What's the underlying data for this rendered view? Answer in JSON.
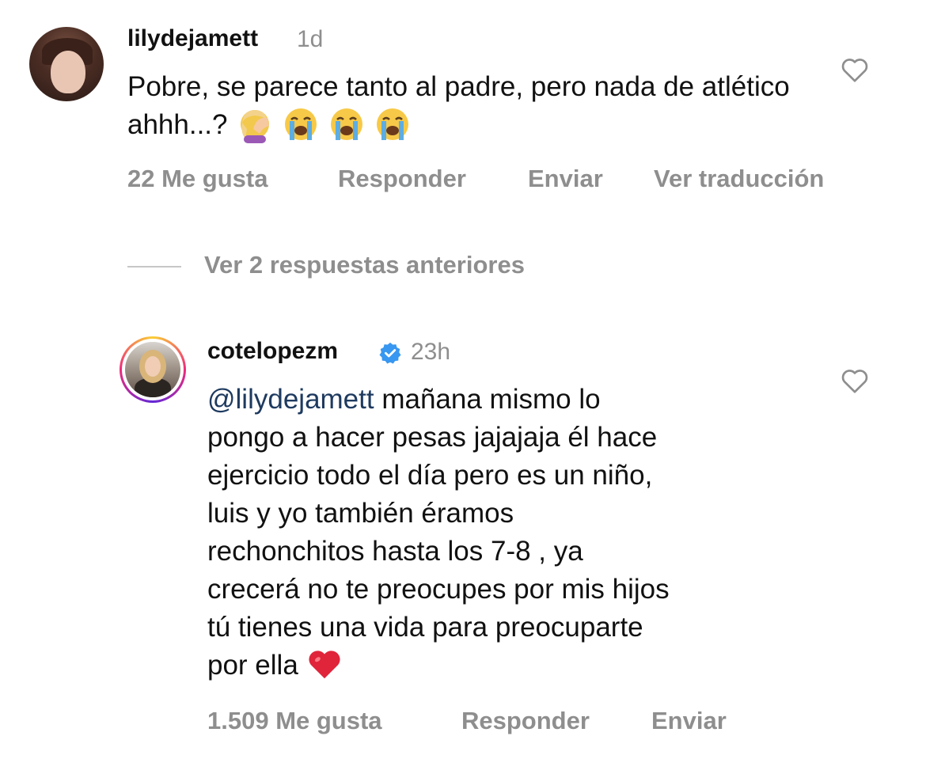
{
  "comment1": {
    "username": "lilydejamett",
    "time": "1d",
    "text": "Pobre, se parece tanto al padre, pero nada de atlético ahhh...?",
    "emojis": [
      "woman-facepalming-emoji",
      "loudly-crying-face-emoji",
      "loudly-crying-face-emoji",
      "loudly-crying-face-emoji"
    ],
    "likes": "22 Me gusta",
    "reply": "Responder",
    "send": "Enviar",
    "translate": "Ver traducción",
    "icon": "heart-outline-icon"
  },
  "view_replies": "Ver 2 respuestas anteriores",
  "comment2": {
    "username": "cotelopezm",
    "verified": true,
    "time": "23h",
    "mention": "@lilydejamett",
    "text_lines": [
      "mañana mismo lo",
      "pongo a hacer pesas jajajaja él hace",
      "ejercicio todo el día pero es un niño,",
      "luis y yo también éramos",
      "rechonchitos hasta los 7-8 , ya",
      "crecerá no te preocupes por mis hijos",
      "tú tienes una vida para preocuparte",
      "por ella"
    ],
    "emoji": "red-heart-emoji",
    "likes": "1.509 Me gusta",
    "reply": "Responder",
    "send": "Enviar",
    "icon": "heart-outline-icon"
  },
  "colors": {
    "text": "#111111",
    "muted": "#8e8e8e",
    "mention": "#1e3a5f",
    "verified": "#3897f0",
    "heart_emoji": "#e0243a"
  }
}
